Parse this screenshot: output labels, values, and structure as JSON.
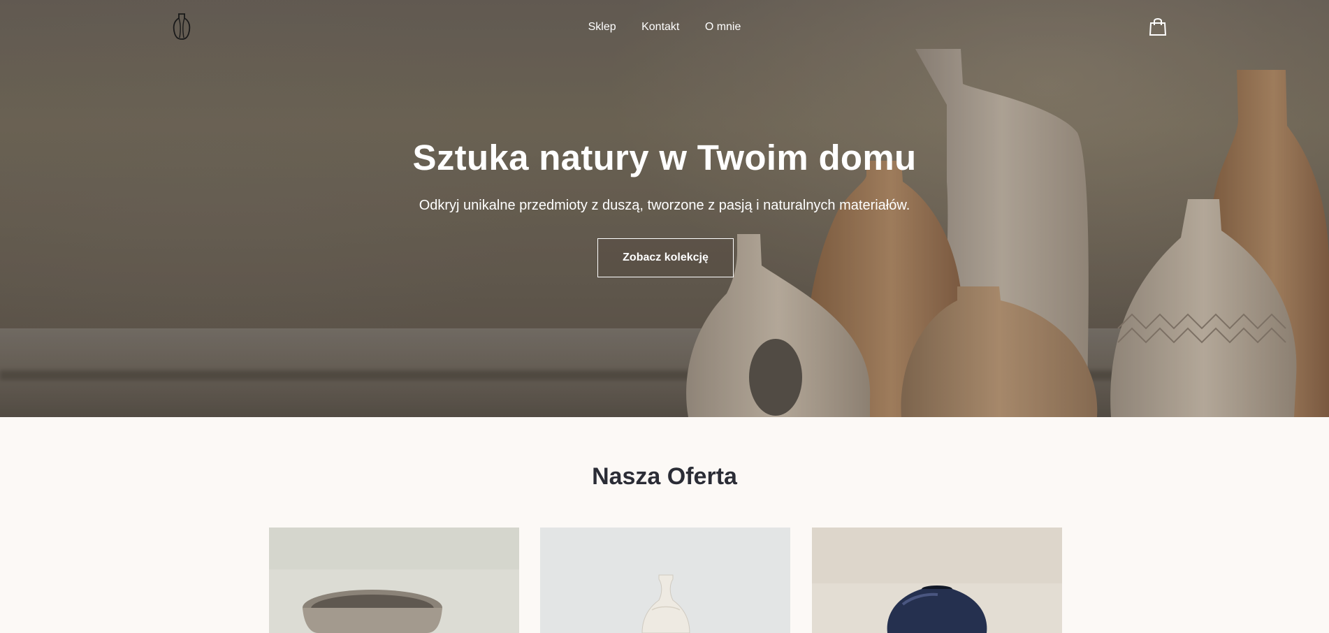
{
  "nav": {
    "items": [
      {
        "label": "Sklep"
      },
      {
        "label": "Kontakt"
      },
      {
        "label": "O mnie"
      }
    ],
    "logo_icon": "vase-logo-icon",
    "cart_icon": "shopping-bag-icon"
  },
  "hero": {
    "title": "Sztuka natury w Twoim domu",
    "subtitle": "Odkryj unikalne przedmioty z duszą, tworzone z pasją i naturalnych materiałów.",
    "cta_label": "Zobacz kolekcję"
  },
  "offer": {
    "title": "Nasza Oferta",
    "products": [
      {
        "image": "ceramic-bowl"
      },
      {
        "image": "white-bottle-vase"
      },
      {
        "image": "navy-round-vase"
      }
    ]
  },
  "colors": {
    "background": "#fcf9f6",
    "heading": "#2b2d36",
    "hero_text": "#ffffff"
  }
}
